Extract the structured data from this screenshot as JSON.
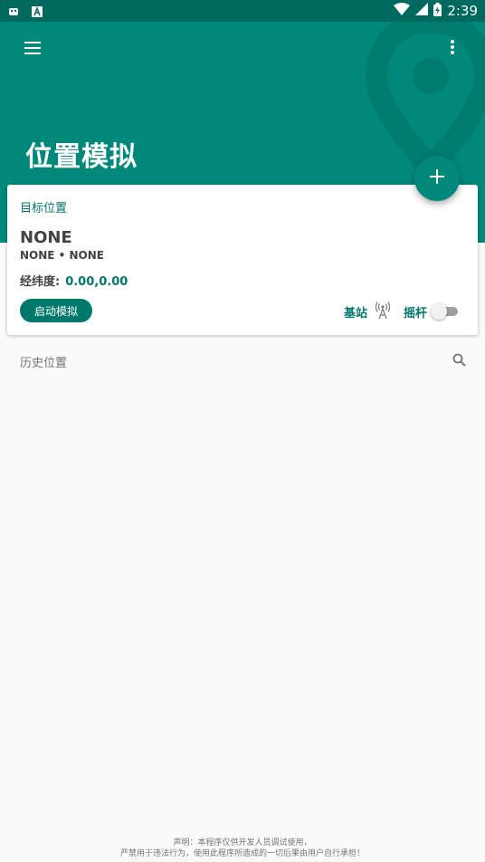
{
  "status_bar": {
    "time": "2:39",
    "icons": [
      "notification-icon",
      "app-icon",
      "wifi-icon",
      "signal-icon",
      "battery-icon"
    ]
  },
  "app_bar": {
    "title": "位置模拟",
    "menu_icon": "menu-icon",
    "more_icon": "more-vert-icon",
    "color": "#00897b"
  },
  "fab": {
    "icon": "add-icon"
  },
  "card": {
    "label": "目标位置",
    "name": "NONE",
    "subtitle": "NONE • NONE",
    "coord_label": "经纬度:",
    "coord_value": "0.00,0.00",
    "start_button": "启动模拟",
    "station_label": "基站",
    "station_icon": "antenna-icon",
    "joystick_label": "摇杆",
    "joystick_enabled": false
  },
  "history": {
    "title": "历史位置",
    "search_icon": "search-icon"
  },
  "disclaimer": {
    "line1": "声明：本程序仅供开发人员调试使用，",
    "line2": "严禁用于违法行为，使用此程序所造成的一切后果由用户自行承担！"
  },
  "colors": {
    "primary": "#00897b",
    "primary_dark": "#00695f",
    "accent_text": "#00796b"
  }
}
